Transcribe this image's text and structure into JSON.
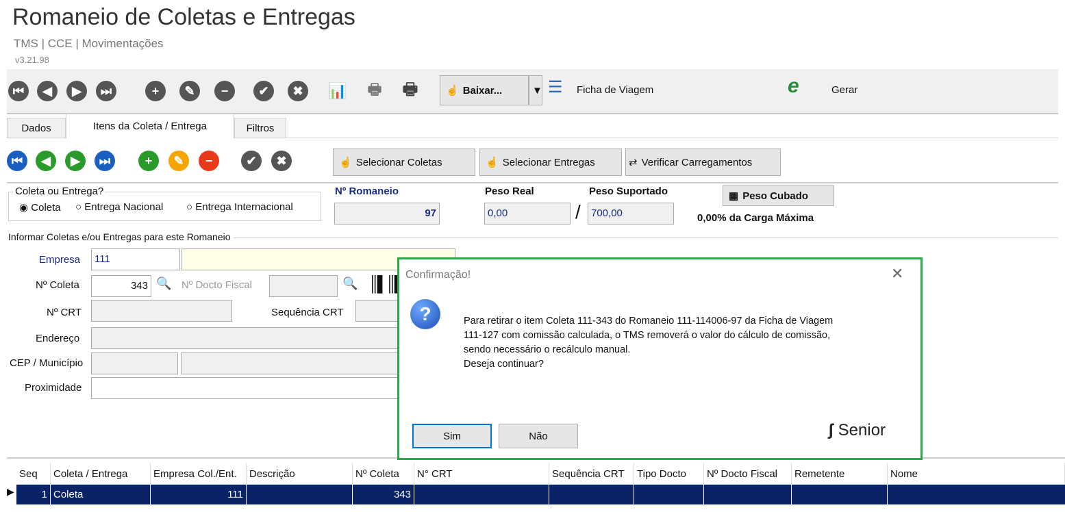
{
  "header": {
    "title": "Romaneio de Coletas e Entregas",
    "breadcrumb": "TMS | CCE | Movimentações",
    "version": "v3.21.98"
  },
  "toolbar": {
    "baixar_label": "Baixar...",
    "ficha_label": "Ficha de Viagem",
    "gerar_label": "Gerar"
  },
  "tabs": [
    {
      "label": "Dados"
    },
    {
      "label": "Itens da Coleta / Entrega"
    },
    {
      "label": "Filtros"
    }
  ],
  "sub_toolbar": {
    "selecionar_coletas": "Selecionar Coletas",
    "selecionar_entregas": "Selecionar Entregas",
    "verificar": "Verificar Carregamentos"
  },
  "form": {
    "tipo_group": "Coleta ou Entrega?",
    "options": [
      "Coleta",
      "Entrega Nacional",
      "Entrega Internacional"
    ],
    "selected": "Coleta",
    "romaneio_label": "Nº Romaneio",
    "romaneio_value": "97",
    "peso_real_label": "Peso Real",
    "peso_real_value": "0,00",
    "peso_sup_label": "Peso Suportado",
    "peso_sup_value": "700,00",
    "peso_cubado": "Peso Cubado",
    "carga": "0,00% da Carga Máxima",
    "informar_group": "Informar Coletas e/ou Entregas para este Romaneio",
    "empresa_label": "Empresa",
    "empresa_value": "111",
    "coleta_label": "Nº Coleta",
    "coleta_value": "343",
    "docto_label": "Nº Docto Fiscal",
    "crt_label": "Nº CRT",
    "seq_crt_label": "Sequência CRT",
    "endereco_label": "Endereço",
    "cep_label": "CEP / Município",
    "proximidade_label": "Proximidade"
  },
  "dialog": {
    "title": "Confirmação!",
    "message": [
      "Para retirar o item Coleta 111-343 do Romaneio 111-114006-97 da Ficha de Viagem",
      "111-127 com comissão calculada, o TMS removerá o valor do cálculo de comissão,",
      "sendo necessário o recálculo manual.",
      "Deseja continuar?"
    ],
    "yes": "Sim",
    "no": "Não",
    "brand": "Senior",
    "accent": "#2aa84a"
  },
  "grid": {
    "columns": [
      "Seq",
      "Coleta / Entrega",
      "Empresa Col./Ent.",
      "Descrição",
      "Nº Coleta",
      "N° CRT",
      "Sequência CRT",
      "Tipo Docto",
      "Nº Docto Fiscal",
      "Remetente",
      "Nome"
    ],
    "rows": [
      {
        "seq": "1",
        "tipo": "Coleta",
        "empresa": "111",
        "coleta": "343"
      }
    ],
    "selected_color": "#0a2266"
  }
}
